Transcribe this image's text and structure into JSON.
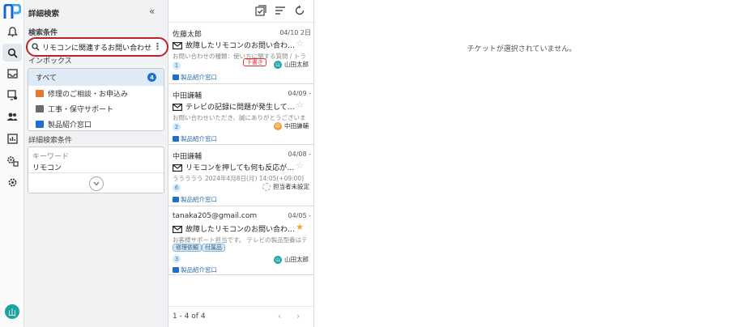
{
  "sidebar_rail": {
    "logo": "ReplyApp logo",
    "icons": [
      "bell-icon",
      "search-icon",
      "inbox-icon",
      "ticket-assign-icon",
      "users-icon",
      "chart-icon",
      "settings-multi-icon",
      "gear-icon"
    ],
    "avatar_label": "山"
  },
  "search_panel": {
    "title": "詳細検索",
    "collapse_icon": "«",
    "conditions_label": "検索条件",
    "search_query": "リモコンに関連するお問い合わせ",
    "inbox_label": "インボックス",
    "inboxes": [
      {
        "label": "すべて",
        "count": "4",
        "color": ""
      },
      {
        "label": "修理のご相談・お申込み",
        "color": "#e8772e"
      },
      {
        "label": "工事・保守サポート",
        "color": "#6b6b6b"
      },
      {
        "label": "製品紹介窓口",
        "color": "#1f6fd1"
      }
    ],
    "detail_label": "詳細検索条件",
    "keyword_label": "キーワード",
    "keyword_value": "リモコン"
  },
  "ticket_list": {
    "tickets": [
      {
        "from": "佐藤太郎",
        "date": "04/10 2日",
        "subject": "故障したリモコンのお問い合わ…",
        "preview": "お問い合わせの種類：使い方に関する質問 / トラ…",
        "count": "1",
        "tag": "下書き",
        "assignee": "山田太郎",
        "assignee_initial": "山",
        "assignee_color": "#1aa3a1",
        "inbox": "製品紹介窓口",
        "starred": false
      },
      {
        "from": "中田謙輔",
        "date": "04/09 -",
        "subject": "テレビの記録に問題が発生して…",
        "preview": "お問い合わせいただき、誠にありがとうございま…",
        "count": "2",
        "assignee": "中田謙輔",
        "assignee_initial": "中",
        "assignee_color": "#f0a040",
        "inbox": "製品紹介窓口",
        "starred": false
      },
      {
        "from": "中田謙輔",
        "date": "04/08 -",
        "subject": "リモコンを押しても何も反応が…",
        "preview": "ううううう 2024年4月8日(月) 14:05(+09:00) …",
        "count": "6",
        "assignee": "担当者未設定",
        "assignee_initial": "",
        "assignee_color": "",
        "inbox": "製品紹介窓口",
        "starred": false
      },
      {
        "from": "tanaka205@gmail.com",
        "date": "04/05 -",
        "subject": "故障したリモコンのお問い合わ…",
        "preview": "お客様サポート担当です。 テレビの製品型番はテ…",
        "count": "3",
        "tags": [
          "修理依頼",
          "付属品"
        ],
        "assignee": "山田太郎",
        "assignee_initial": "山",
        "assignee_color": "#1aa3a1",
        "inbox": "製品紹介窓口",
        "starred": true
      }
    ],
    "pagination": "1 - 4 of 4",
    "prev_icon": "‹",
    "next_icon": "›"
  },
  "detail_panel": {
    "empty_message": "チケットが選択されていません。"
  }
}
